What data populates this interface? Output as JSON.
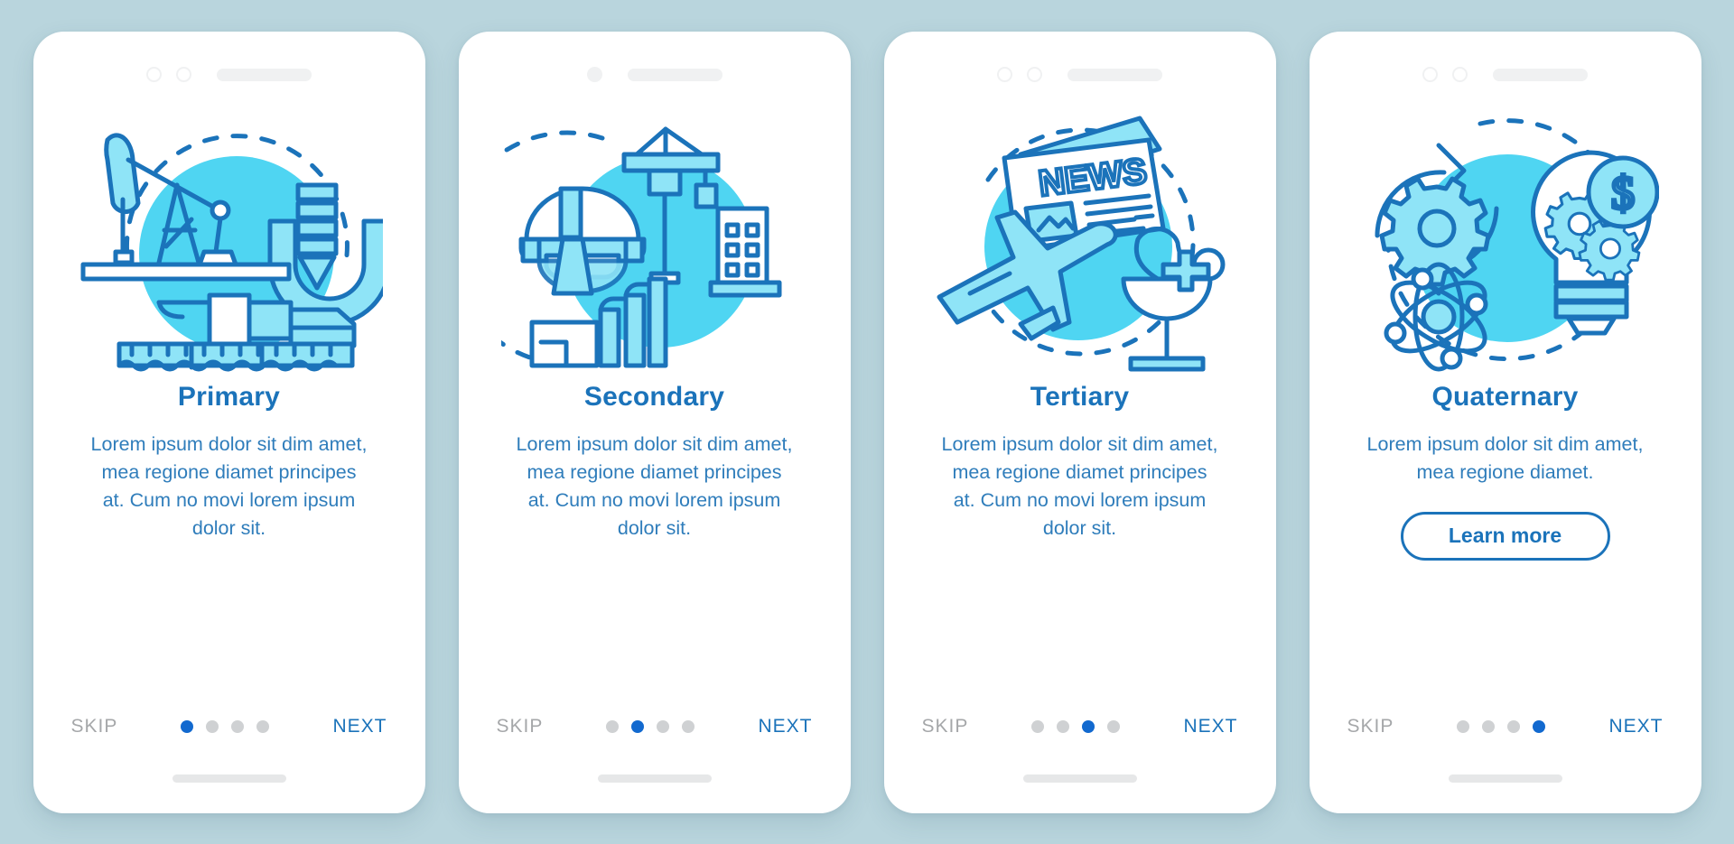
{
  "background_color": "#b9d5dd",
  "accent_color": "#1b73ba",
  "accent_dot_color": "#1269cf",
  "illustration_fill": "#8fe4f7",
  "illustration_blob": "#4fd5f2",
  "screens": [
    {
      "id": "primary",
      "illustration": "oil-pump-drill-mining-icon",
      "title": "Primary",
      "description": "Lorem ipsum dolor sit dim amet, mea regione diamet principes at. Cum no movi lorem ipsum dolor sit.",
      "has_learn_more": false,
      "learn_more_label": "",
      "skip_label": "SKIP",
      "next_label": "NEXT",
      "dots": {
        "count": 4,
        "active_index": 0
      },
      "header": {
        "circles": [
          "outline",
          "outline"
        ],
        "bar": true
      }
    },
    {
      "id": "secondary",
      "illustration": "hardhat-crane-factory-icon",
      "title": "Secondary",
      "description": "Lorem ipsum dolor sit dim amet, mea regione diamet principes at. Cum no movi lorem ipsum dolor sit.",
      "has_learn_more": false,
      "learn_more_label": "",
      "skip_label": "SKIP",
      "next_label": "NEXT",
      "dots": {
        "count": 4,
        "active_index": 1
      },
      "header": {
        "circles": [
          "filled"
        ],
        "bar": true
      }
    },
    {
      "id": "tertiary",
      "illustration": "newspaper-airplane-medical-icon",
      "title": "Tertiary",
      "description": "Lorem ipsum dolor sit dim amet, mea regione diamet principes at. Cum no movi lorem ipsum dolor sit.",
      "has_learn_more": false,
      "learn_more_label": "",
      "skip_label": "SKIP",
      "next_label": "NEXT",
      "dots": {
        "count": 4,
        "active_index": 2
      },
      "header": {
        "circles": [
          "outline",
          "outline"
        ],
        "bar": true
      }
    },
    {
      "id": "quaternary",
      "illustration": "gear-atom-lightbulb-dollar-icon",
      "title": "Quaternary",
      "description": "Lorem ipsum dolor sit dim amet, mea regione diamet.",
      "has_learn_more": true,
      "learn_more_label": "Learn more",
      "skip_label": "SKIP",
      "next_label": "NEXT",
      "dots": {
        "count": 4,
        "active_index": 3
      },
      "header": {
        "circles": [
          "outline",
          "outline"
        ],
        "bar": true
      }
    }
  ],
  "illustration_text": {
    "news_headline": "NEWS",
    "dollar_sign": "$"
  }
}
